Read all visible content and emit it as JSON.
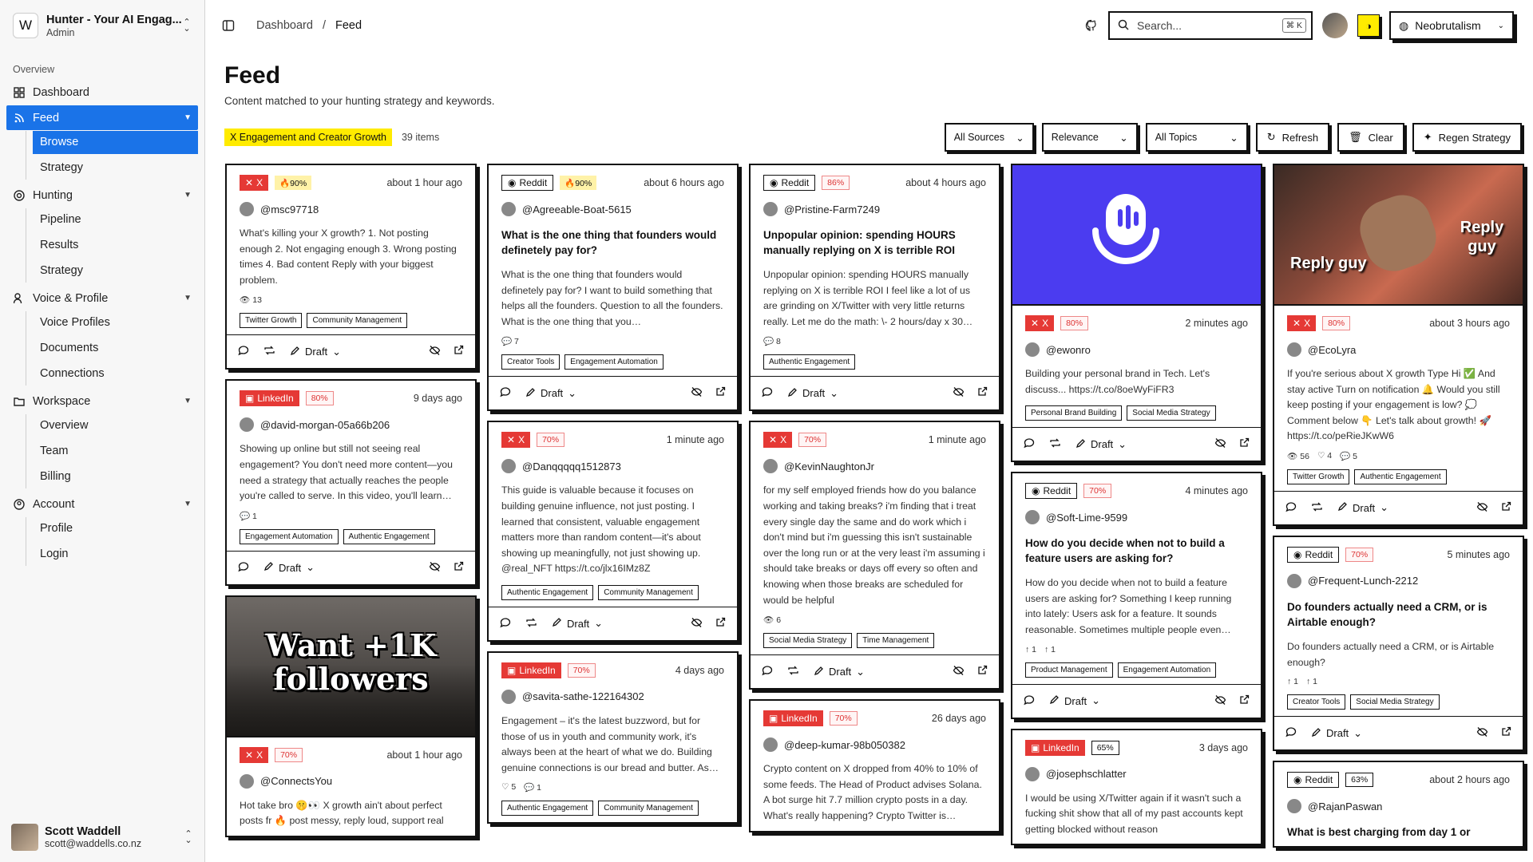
{
  "workspace": {
    "title": "Hunter - Your AI Engag...",
    "subtitle": "Admin",
    "logo": "W"
  },
  "sidebar": {
    "section_label": "Overview",
    "dashboard": "Dashboard",
    "feed": {
      "label": "Feed",
      "children": [
        "Browse",
        "Strategy"
      ]
    },
    "hunting": {
      "label": "Hunting",
      "children": [
        "Pipeline",
        "Results",
        "Strategy"
      ]
    },
    "voice": {
      "label": "Voice & Profile",
      "children": [
        "Voice Profiles",
        "Documents",
        "Connections"
      ]
    },
    "workspace": {
      "label": "Workspace",
      "children": [
        "Overview",
        "Team",
        "Billing"
      ]
    },
    "account": {
      "label": "Account",
      "children": [
        "Profile",
        "Login"
      ]
    }
  },
  "user": {
    "name": "Scott Waddell",
    "email": "scott@waddells.co.nz"
  },
  "topbar": {
    "crumbs": [
      "Dashboard",
      "Feed"
    ],
    "search_placeholder": "Search...",
    "shortcut": "⌘ K",
    "style": "Neobrutalism"
  },
  "page": {
    "title": "Feed",
    "subtitle": "Content matched to your hunting strategy and keywords."
  },
  "filters": {
    "strategy": "X Engagement and Creator Growth",
    "count": "39 items",
    "sources": "All Sources",
    "sort": "Relevance",
    "topics": "All Topics",
    "refresh": "Refresh",
    "clear": "Clear",
    "regen": "Regen Strategy"
  },
  "colors": {
    "accent": "#1a73e8",
    "x_red": "#e53935",
    "highlight": "#ffeb00"
  },
  "columns": [
    [
      {
        "source": "X",
        "kind": "x",
        "score": "🔥90%",
        "score_style": "hot",
        "time": "about 1 hour ago",
        "author": "@msc97718",
        "text": "What's killing your X growth? 1. Not posting enough 2. Not engaging enough 3. Wrong posting times 4. Bad content Reply with your biggest problem.",
        "stats": [
          "👁 13"
        ],
        "tags": [
          "Twitter Growth",
          "Community Management"
        ],
        "draft": true,
        "retweet": true
      },
      {
        "source": "LinkedIn",
        "kind": "li",
        "score": "80%",
        "score_style": "red",
        "time": "9 days ago",
        "author": "@david-morgan-05a66b206",
        "text": "Showing up online but still not seeing real engagement? You don't need more content—you need a strategy that actually reaches the people you're called to serve. In this video, you'll learn…",
        "stats": [
          "💬 1"
        ],
        "tags": [
          "Engagement Automation",
          "Authentic Engagement"
        ],
        "draft": true,
        "retweet": false
      },
      {
        "media": "followers",
        "media_text": "Want +1K followers",
        "source": "X",
        "kind": "x",
        "score": "70%",
        "score_style": "red",
        "time": "about 1 hour ago",
        "author": "@ConnectsYou",
        "text": "Hot take bro 🤫👀 X growth ain't about perfect posts fr 🔥 post messy, reply loud, support real",
        "stats": [],
        "tags": [],
        "draft": false,
        "retweet": false
      }
    ],
    [
      {
        "source": "Reddit",
        "kind": "rd",
        "score": "🔥90%",
        "score_style": "hot",
        "time": "about 6 hours ago",
        "author": "@Agreeable-Boat-5615",
        "title": "What is the one thing that founders would definetely pay for?",
        "text": "What is the one thing that founders would definetely pay for? I want to build something that helps all the founders. Question to all the founders. What is the one thing that you…",
        "stats": [
          "💬 7"
        ],
        "tags": [
          "Creator Tools",
          "Engagement Automation"
        ],
        "draft": true,
        "retweet": false
      },
      {
        "source": "X",
        "kind": "x",
        "score": "70%",
        "score_style": "red",
        "time": "1 minute ago",
        "author": "@Danqqqqq1512873",
        "text": "This guide is valuable because it focuses on building genuine influence, not just posting. I learned that consistent, valuable engagement matters more than random content—it's about showing up meaningfully, not just showing up. @real_NFT https://t.co/jlx16IMz8Z",
        "stats": [],
        "tags": [
          "Authentic Engagement",
          "Community Management"
        ],
        "draft": true,
        "retweet": true
      },
      {
        "source": "LinkedIn",
        "kind": "li",
        "score": "70%",
        "score_style": "red",
        "time": "4 days ago",
        "author": "@savita-sathe-122164302",
        "text": "Engagement – it's the latest buzzword, but for those of us in youth and community work, it's always been at the heart of what we do. Building genuine connections is our bread and butter. As…",
        "stats": [
          "♡ 5",
          "💬 1"
        ],
        "tags": [
          "Authentic Engagement",
          "Community Management"
        ],
        "draft": false,
        "retweet": false
      }
    ],
    [
      {
        "source": "Reddit",
        "kind": "rd",
        "score": "86%",
        "score_style": "red",
        "time": "about 4 hours ago",
        "author": "@Pristine-Farm7249",
        "title": "Unpopular opinion: spending HOURS manually replying on X is terrible ROI",
        "text": "Unpopular opinion: spending HOURS manually replying on X is terrible ROI I feel like a lot of us are grinding on X/Twitter with very little returns really. Let me do the math: \\- 2 hours/day x 30…",
        "stats": [
          "💬 8"
        ],
        "tags": [
          "Authentic Engagement"
        ],
        "draft": true,
        "retweet": false
      },
      {
        "source": "X",
        "kind": "x",
        "score": "70%",
        "score_style": "red",
        "time": "1 minute ago",
        "author": "@KevinNaughtonJr",
        "text": "for my self employed friends how do you balance working and taking breaks? i'm finding that i treat every single day the same and do work which i don't mind but i'm guessing this isn't sustainable over the long run or at the very least i'm assuming i should take breaks or days off every so often and knowing when those breaks are scheduled for would be helpful",
        "stats": [
          "👁 6"
        ],
        "tags": [
          "Social Media Strategy",
          "Time Management"
        ],
        "draft": true,
        "retweet": true
      },
      {
        "source": "LinkedIn",
        "kind": "li",
        "score": "70%",
        "score_style": "red",
        "time": "26 days ago",
        "author": "@deep-kumar-98b050382",
        "text": "Crypto content on X dropped from 40% to 10% of some feeds. The Head of Product advises Solana. A bot surge hit 7.7 million crypto posts in a day. What's really happening? Crypto Twitter is…",
        "stats": [],
        "tags": [],
        "draft": false,
        "retweet": false
      }
    ],
    [
      {
        "media": "mic",
        "source": "X",
        "kind": "x",
        "score": "80%",
        "score_style": "red",
        "time": "2 minutes ago",
        "author": "@ewonro",
        "text": "Building your personal brand in Tech. Let's discuss... https://t.co/8oeWyFiFR3",
        "stats": [],
        "tags": [
          "Personal Brand Building",
          "Social Media Strategy"
        ],
        "draft": true,
        "retweet": true
      },
      {
        "source": "Reddit",
        "kind": "rd",
        "score": "70%",
        "score_style": "red",
        "time": "4 minutes ago",
        "author": "@Soft-Lime-9599",
        "title": "How do you decide when not to build a feature users are asking for?",
        "text": "How do you decide when not to build a feature users are asking for? Something I keep running into lately: Users ask for a feature. It sounds reasonable. Sometimes multiple people even…",
        "stats": [
          "↑ 1",
          "↑ 1"
        ],
        "tags": [
          "Product Management",
          "Engagement Automation"
        ],
        "draft": true,
        "retweet": false
      },
      {
        "source": "LinkedIn",
        "kind": "li",
        "score": "65%",
        "score_style": "plain",
        "time": "3 days ago",
        "author": "@josephschlatter",
        "text": "I would be using X/Twitter again if it wasn't such a fucking shit show that all of my past accounts kept getting blocked without reason",
        "stats": [],
        "tags": [],
        "draft": false,
        "retweet": false
      }
    ],
    [
      {
        "media": "handshake",
        "media_left": "Reply guy",
        "media_right": "Reply guy",
        "source": "X",
        "kind": "x",
        "score": "80%",
        "score_style": "red",
        "time": "about 3 hours ago",
        "author": "@EcoLyra",
        "text": "If you're serious about X growth Type Hi ✅ And stay active Turn on notification 🔔 Would you still keep posting if your engagement is low? 💭 Comment below 👇 Let's talk about growth! 🚀 https://t.co/peRieJKwW6",
        "stats": [
          "👁 56",
          "♡ 4",
          "💬 5"
        ],
        "tags": [
          "Twitter Growth",
          "Authentic Engagement"
        ],
        "draft": true,
        "retweet": true
      },
      {
        "source": "Reddit",
        "kind": "rd",
        "score": "70%",
        "score_style": "red",
        "time": "5 minutes ago",
        "author": "@Frequent-Lunch-2212",
        "title": "Do founders actually need a CRM, or is Airtable enough?",
        "text": "Do founders actually need a CRM, or is Airtable enough?",
        "stats": [
          "↑ 1",
          "↑ 1"
        ],
        "tags": [
          "Creator Tools",
          "Social Media Strategy"
        ],
        "draft": true,
        "retweet": false
      },
      {
        "source": "Reddit",
        "kind": "rd",
        "score": "63%",
        "score_style": "plain",
        "time": "about 2 hours ago",
        "author": "@RajanPaswan",
        "title": "What is best charging from day 1 or",
        "stats": [],
        "tags": [],
        "draft": false,
        "retweet": false
      }
    ]
  ]
}
